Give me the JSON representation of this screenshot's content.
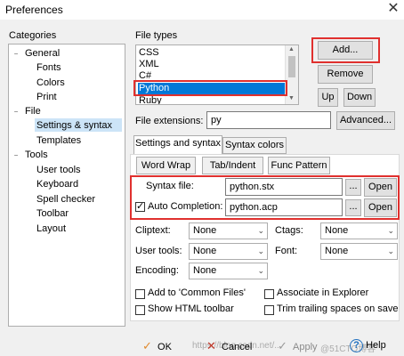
{
  "window": {
    "title": "Preferences",
    "close_glyph": "✕"
  },
  "categories": {
    "label": "Categories",
    "items": [
      {
        "label": "General",
        "level": 0,
        "expander": "−"
      },
      {
        "label": "Fonts",
        "level": 1
      },
      {
        "label": "Colors",
        "level": 1
      },
      {
        "label": "Print",
        "level": 1
      },
      {
        "label": "File",
        "level": 0,
        "expander": "−"
      },
      {
        "label": "Settings & syntax",
        "level": 1,
        "selected": true
      },
      {
        "label": "Templates",
        "level": 1
      },
      {
        "label": "Tools",
        "level": 0,
        "expander": "−"
      },
      {
        "label": "User tools",
        "level": 1
      },
      {
        "label": "Keyboard",
        "level": 1
      },
      {
        "label": "Spell checker",
        "level": 1
      },
      {
        "label": "Toolbar",
        "level": 1
      },
      {
        "label": "Layout",
        "level": 1
      }
    ]
  },
  "file_types": {
    "label": "File types",
    "items": [
      "CSS",
      "XML",
      "C#",
      "Python",
      "Ruby"
    ],
    "selected": "Python",
    "add_label": "Add...",
    "remove_label": "Remove",
    "up_label": "Up",
    "down_label": "Down"
  },
  "extensions": {
    "label": "File extensions:",
    "value": "py",
    "advanced_label": "Advanced..."
  },
  "tabs": {
    "settings": "Settings and syntax",
    "colors": "Syntax colors"
  },
  "subtabs": {
    "word_wrap": "Word Wrap",
    "tab_indent": "Tab/Indent",
    "func_pattern": "Func Pattern"
  },
  "syntax": {
    "syntax_label": "Syntax file:",
    "syntax_value": "python.stx",
    "auto_label": "Auto Completion:",
    "auto_value": "python.acp",
    "auto_checked": true,
    "browse_label": "...",
    "open_label": "Open"
  },
  "options": {
    "cliptext_label": "Cliptext:",
    "cliptext_value": "None",
    "ctags_label": "Ctags:",
    "ctags_value": "None",
    "usertools_label": "User tools:",
    "usertools_value": "None",
    "font_label": "Font:",
    "font_value": "None",
    "encoding_label": "Encoding:",
    "encoding_value": "None"
  },
  "checkboxes": {
    "common_files": "Add to 'Common Files'",
    "associate": "Associate in Explorer",
    "html_toolbar": "Show HTML toolbar",
    "trim_spaces": "Trim trailing spaces on save"
  },
  "footer": {
    "ok": "OK",
    "cancel": "Cancel",
    "apply": "Apply",
    "help": "Help",
    "watermark_left": "https://blog.csdn.net/...",
    "watermark_right": "@51CTO博客"
  },
  "colors": {
    "highlight": "#e0302e",
    "selection": "#0078d7",
    "tree_selection": "#cce4f7"
  }
}
